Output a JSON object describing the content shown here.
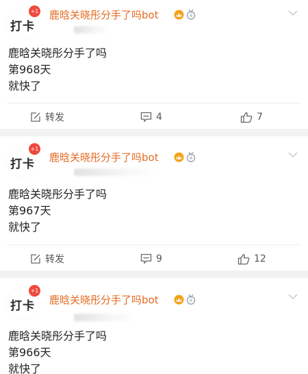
{
  "posts": [
    {
      "avatar_text": "打卡",
      "badge": "+1",
      "username": "鹿晗关晓彤分手了吗bot",
      "vip_icons": [
        "vip-crown-icon",
        "medal-icon"
      ],
      "lines": [
        "鹿晗关晓彤分手了吗",
        "第968天",
        "就快了"
      ],
      "repost_label": "转发",
      "comments": "4",
      "likes": "7"
    },
    {
      "avatar_text": "打卡",
      "badge": "+1",
      "username": "鹿晗关晓彤分手了吗bot",
      "vip_icons": [
        "vip-crown-icon",
        "medal-icon"
      ],
      "lines": [
        "鹿晗关晓彤分手了吗",
        "第967天",
        "就快了"
      ],
      "repost_label": "转发",
      "comments": "9",
      "likes": "12"
    },
    {
      "avatar_text": "打卡",
      "badge": "+1",
      "username": "鹿晗关晓彤分手了吗bot",
      "vip_icons": [
        "vip-crown-icon",
        "medal-icon"
      ],
      "lines": [
        "鹿晗关晓彤分手了吗",
        "第966天",
        "就快了"
      ]
    }
  ],
  "colors": {
    "username": "#e46b22",
    "badge": "#f0493e",
    "separator": "#f2f2f2"
  }
}
